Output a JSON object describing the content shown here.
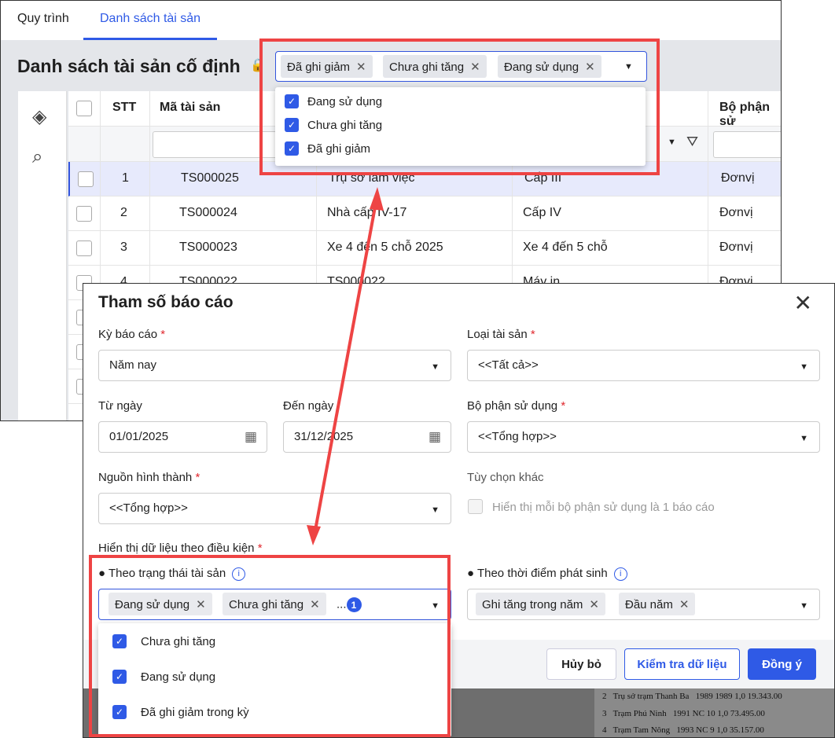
{
  "tabs": [
    "Quy trình",
    "Danh sách tài sản"
  ],
  "page_title": "Danh sách tài sản cố định",
  "status_filter": {
    "chips": [
      "Đã ghi giảm",
      "Chưa ghi tăng",
      "Đang sử dụng"
    ],
    "options": [
      "Đang sử dụng",
      "Chưa ghi tăng",
      "Đã ghi giảm"
    ]
  },
  "table": {
    "headers": [
      "STT",
      "Mã tài sản",
      "Bộ phận sử"
    ],
    "rows": [
      {
        "stt": "1",
        "code": "TS000025",
        "name": "Trụ sở làm việc",
        "type": "Cấp III",
        "dept": "Đơnvị"
      },
      {
        "stt": "2",
        "code": "TS000024",
        "name": "Nhà cấp IV-17",
        "type": "Cấp IV",
        "dept": "Đơnvị"
      },
      {
        "stt": "3",
        "code": "TS000023",
        "name": "Xe 4 đến 5 chỗ 2025",
        "type": "Xe 4 đến 5 chỗ",
        "dept": "Đơnvị"
      },
      {
        "stt": "4",
        "code": "TS000022",
        "name": "TS000022",
        "type": "Máy in",
        "dept": "Đơnvị"
      }
    ]
  },
  "dialog": {
    "title": "Tham số báo cáo",
    "ky_bao_cao": {
      "label": "Kỳ báo cáo",
      "value": "Năm nay"
    },
    "loai_tai_san": {
      "label": "Loại tài sản",
      "value": "<<Tất cả>>"
    },
    "tu_ngay": {
      "label": "Từ ngày",
      "value": "01/01/2025"
    },
    "den_ngay": {
      "label": "Đến ngày",
      "value": "31/12/2025"
    },
    "bo_phan": {
      "label": "Bộ phận sử dụng",
      "value": "<<Tổng hợp>>"
    },
    "nguon": {
      "label": "Nguồn hình thành",
      "value": "<<Tổng hợp>>"
    },
    "tuy_chon": {
      "label": "Tùy chọn khác",
      "checkbox": "Hiển thị mỗi bộ phận sử dụng là 1 báo cáo"
    },
    "dieu_kien_label": "Hiển thị dữ liệu theo điều kiện",
    "trang_thai": {
      "label": "● Theo trạng thái tài sản",
      "chips": [
        "Đang sử dụng",
        "Chưa ghi tăng"
      ],
      "more": "...",
      "more_count": "1",
      "options": [
        "Chưa ghi tăng",
        "Đang sử dụng",
        "Đã ghi giảm trong kỳ"
      ]
    },
    "thoi_diem": {
      "label": "● Theo thời điểm phát sinh",
      "chips": [
        "Ghi tăng trong năm",
        "Đầu năm"
      ]
    },
    "buttons": {
      "cancel": "Hủy bỏ",
      "check": "Kiểm tra dữ liệu",
      "ok": "Đồng ý"
    },
    "bg_rows": [
      [
        "2",
        "Trụ sở trạm Thanh Ba",
        "1989",
        "1989",
        "1,0",
        "19.343.00"
      ],
      [
        "3",
        "Trạm Phú Ninh",
        "",
        "1991",
        "NC 10",
        "1,0",
        "73.495.00"
      ],
      [
        "4",
        "Trạm Tam Nông",
        "",
        "1993",
        "NC 9",
        "1,0",
        "35.157.00"
      ]
    ]
  },
  "colors": {
    "accent": "#2f5ae6",
    "annotation": "#ee4444"
  }
}
